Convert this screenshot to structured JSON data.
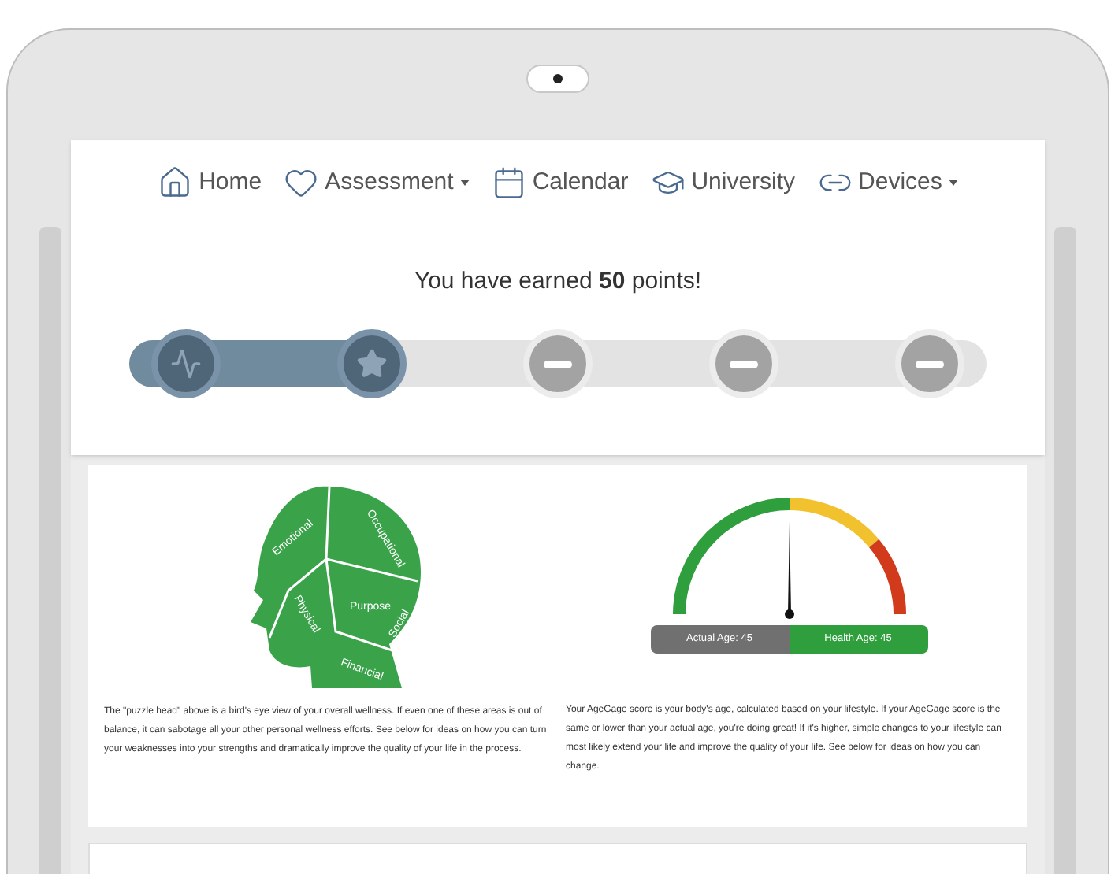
{
  "nav": [
    {
      "kind": "home",
      "label": "Home",
      "dropdown": false
    },
    {
      "kind": "heart",
      "label": "Assessment",
      "dropdown": true
    },
    {
      "kind": "calendar",
      "label": "Calendar",
      "dropdown": false
    },
    {
      "kind": "cap",
      "label": "University",
      "dropdown": false
    },
    {
      "kind": "link",
      "label": "Devices",
      "dropdown": true
    }
  ],
  "points_message": "You have earned **50** points!",
  "progress": {
    "level": 0.3,
    "steps": [
      {
        "kind": "runner",
        "completed": true
      },
      {
        "kind": "star",
        "completed": true
      },
      {
        "kind": "locked",
        "completed": false
      },
      {
        "kind": "locked",
        "completed": false
      },
      {
        "kind": "locked",
        "completed": false
      }
    ]
  },
  "puzzle_head": {
    "pieces": [
      "Emotional",
      "Occupational",
      "Physical",
      "Purpose",
      "Social",
      "Financial"
    ],
    "description": "The \"puzzle head\" above is a bird's eye view of your overall wellness. If even one of these areas is out of balance, it can sabotage all your other personal wellness efforts. See below for ideas on how you can turn your weaknesses into your strengths and dramatically improve the quality of your life in the process."
  },
  "age_gauge": {
    "actual_age": "Actual Age: 45",
    "health_age": "Health Age: 45",
    "description": "Your AgeGage score is your body's age, calculated based on your lifestyle. If your AgeGage score is the same or lower than your actual age, you're doing great! If it's higher, simple changes to your lifestyle can most likely extend your life and improve the quality of your life. See below for ideas on how you can change."
  }
}
